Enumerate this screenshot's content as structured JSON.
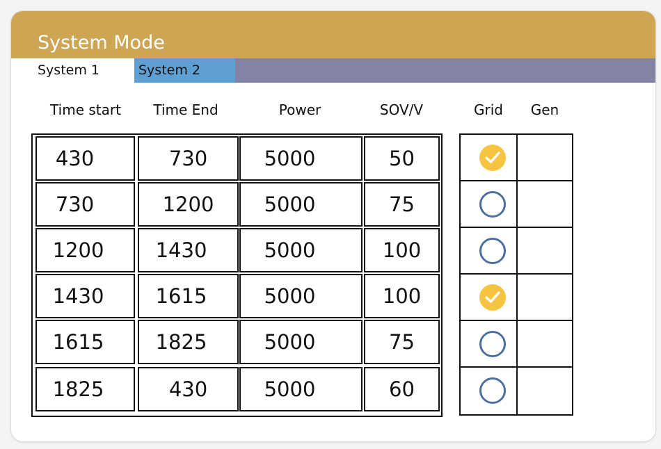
{
  "panel": {
    "title": "System Mode"
  },
  "tabs": [
    {
      "label": "System 1",
      "active": true
    },
    {
      "label": "System 2",
      "active": false
    }
  ],
  "columns": {
    "time_start": "Time start",
    "time_end": "Time End",
    "power": "Power",
    "sov": "SOV/V",
    "grid": "Grid",
    "gen": "Gen"
  },
  "rows": [
    {
      "time_start": "430",
      "time_end": "730",
      "power": "5000",
      "sov": "50",
      "grid": true,
      "gen": false
    },
    {
      "time_start": "730",
      "time_end": "1200",
      "power": "5000",
      "sov": "75",
      "grid": false,
      "gen": false
    },
    {
      "time_start": "1200",
      "time_end": "1430",
      "power": "5000",
      "sov": "100",
      "grid": false,
      "gen": false
    },
    {
      "time_start": "1430",
      "time_end": "1615",
      "power": "5000",
      "sov": "100",
      "grid": true,
      "gen": false
    },
    {
      "time_start": "1615",
      "time_end": "1825",
      "power": "5000",
      "sov": "75",
      "grid": false,
      "gen": false
    },
    {
      "time_start": "1825",
      "time_end": "430",
      "power": "5000",
      "sov": "60",
      "grid": false,
      "gen": false
    }
  ],
  "colors": {
    "header": "#cea653",
    "tab_active": "#ffffff",
    "tab_inactive": "#5ea0d3",
    "tabbar": "#8383a6",
    "radio_checked": "#f6c440",
    "radio_unchecked_border": "#4d6fa0"
  },
  "icons": {
    "checked": "checkmark-circle-icon",
    "unchecked": "empty-circle-icon"
  }
}
